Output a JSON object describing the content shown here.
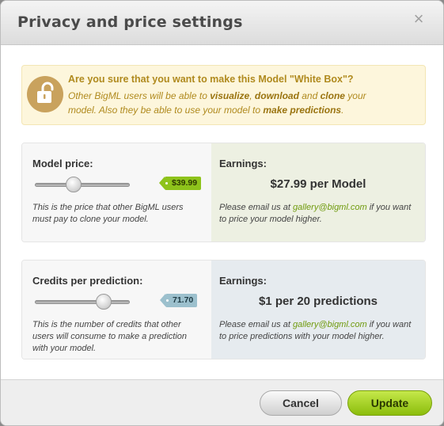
{
  "dialog": {
    "title": "Privacy and price settings",
    "close_glyph": "×"
  },
  "warning": {
    "icon": "unlock-icon",
    "heading": "Are you sure that you want to make this Model \"White Box\"?",
    "line1_a": "Other BigML users will be able to ",
    "visualize": "visualize",
    "comma": ", ",
    "download": "download",
    "and": " and ",
    "clone": "clone",
    "line1_b": " your",
    "line2_a": "model. Also they be able to use your model to ",
    "make_predictions": "make predictions",
    "line2_b": "."
  },
  "model_price": {
    "label": "Model price:",
    "value_tag": "$39.99",
    "slider_fraction": 0.4,
    "description": "This is the price that other BigML users must pay to clone your model.",
    "earnings_label": "Earnings:",
    "earnings_value": "$27.99 per Model",
    "note_a": "Please email us at ",
    "email": "gallery@bigml.com",
    "note_b": " if you want to price your model higher."
  },
  "credits": {
    "label": "Credits per prediction:",
    "value_tag": "71.70",
    "slider_fraction": 0.72,
    "description": "This is the number of credits that other users will consume to make a prediction with your model.",
    "earnings_label": "Earnings:",
    "earnings_value": "$1 per 20 predictions",
    "note_a": "Please email us at ",
    "email": "gallery@bigml.com",
    "note_b": " if you want to price predictions with your model higher."
  },
  "footer": {
    "cancel_label": "Cancel",
    "update_label": "Update"
  },
  "colors": {
    "accent_green": "#8ec31b",
    "tag_blue": "#9cc0cd",
    "warning_text": "#b08a1e",
    "lock_circle": "#c9a25d"
  }
}
